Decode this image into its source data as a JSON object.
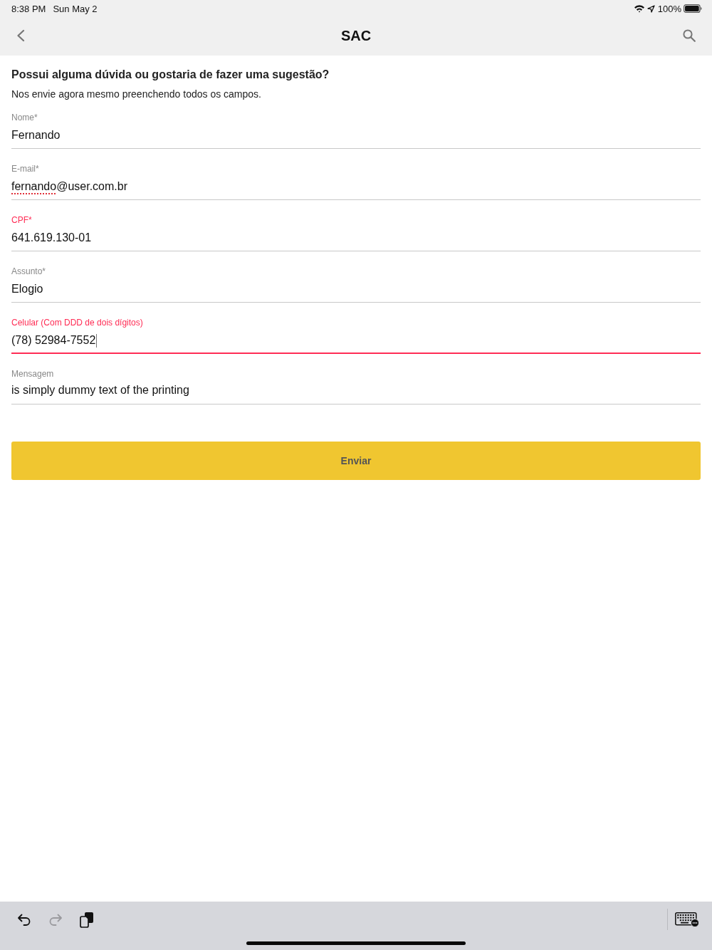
{
  "status_bar": {
    "time": "8:38 PM",
    "date": "Sun May 2",
    "battery": "100%"
  },
  "nav_bar": {
    "title": "SAC"
  },
  "form": {
    "heading": "Possui alguma dúvida ou gostaria de fazer uma sugestão?",
    "subheading": "Nos envie agora mesmo preenchendo todos os campos.",
    "fields": [
      {
        "kind": "single_line",
        "label": "Nome*",
        "value": "Fernando",
        "invalid": false,
        "focused": false
      },
      {
        "kind": "single_line",
        "label": "E-mail*",
        "value_parts": [
          {
            "text": "fernando",
            "misspelled": true
          },
          {
            "text": "@user.com.br",
            "misspelled": false
          }
        ],
        "invalid": false,
        "focused": false
      },
      {
        "kind": "single_line",
        "label": "CPF*",
        "value": "641.619.130-01",
        "invalid": true,
        "focused": false
      },
      {
        "kind": "single_line",
        "label": "Assunto*",
        "value": "Elogio",
        "invalid": false,
        "focused": false
      },
      {
        "kind": "single_line",
        "label": "Celular (Com DDD de dois dígitos)",
        "value": "(78) 52984-7552",
        "invalid": true,
        "focused": true
      },
      {
        "kind": "multiline",
        "label": "Mensagem",
        "value": "is simply dummy text of the printing",
        "invalid": false,
        "focused": false
      }
    ],
    "submit_button": {
      "label": "Enviar"
    }
  },
  "keyboard_bar": {
    "tools": [
      {
        "kind": "undo",
        "disabled": false
      },
      {
        "kind": "redo",
        "disabled": true
      },
      {
        "kind": "paste",
        "disabled": false
      }
    ]
  }
}
